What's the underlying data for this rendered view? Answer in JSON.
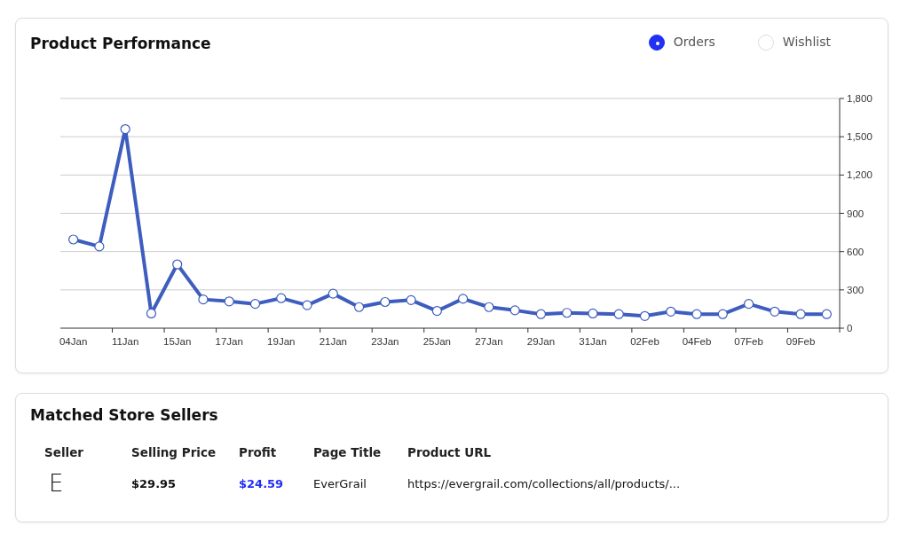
{
  "performance": {
    "title": "Product Performance",
    "options": [
      {
        "label": "Orders",
        "selected": true
      },
      {
        "label": "Wishlist",
        "selected": false
      }
    ],
    "chart_data": {
      "type": "line",
      "categories": [
        "04Jan",
        null,
        "11Jan",
        null,
        "15Jan",
        null,
        "17Jan",
        null,
        "19Jan",
        null,
        "21Jan",
        null,
        "23Jan",
        null,
        "25Jan",
        null,
        "27Jan",
        null,
        "29Jan",
        null,
        "31Jan",
        null,
        "02Feb",
        null,
        "04Feb",
        null,
        "07Feb",
        null,
        "09Feb",
        null
      ],
      "ylim": [
        0,
        1800
      ],
      "grid": true,
      "yticks": [
        {
          "value": 0,
          "label": "0"
        },
        {
          "value": 300,
          "label": "300"
        },
        {
          "value": 600,
          "label": "600"
        },
        {
          "value": 900,
          "label": "900"
        },
        {
          "value": 1200,
          "label": "1,200"
        },
        {
          "value": 1500,
          "label": "1,500"
        },
        {
          "value": 1800,
          "label": "1,800"
        }
      ],
      "series": [
        {
          "color": "#3d5dbf",
          "marker": true,
          "values": [
            695,
            640,
            1560,
            115,
            500,
            225,
            210,
            190,
            235,
            180,
            270,
            165,
            205,
            220,
            135,
            230,
            165,
            140,
            110,
            120,
            115,
            110,
            95,
            130,
            110,
            110,
            190,
            130,
            110,
            110
          ]
        }
      ]
    }
  },
  "sellers": {
    "title": "Matched Store Sellers",
    "columns": [
      "Seller",
      "Selling Price",
      "Profit",
      "Page Title",
      "Product URL"
    ],
    "rows": [
      {
        "seller": "E",
        "selling_price": "$29.95",
        "profit": "$24.59",
        "page_title": "EverGrail",
        "product_url": "https://evergrail.com/collections/all/products/..."
      }
    ]
  }
}
